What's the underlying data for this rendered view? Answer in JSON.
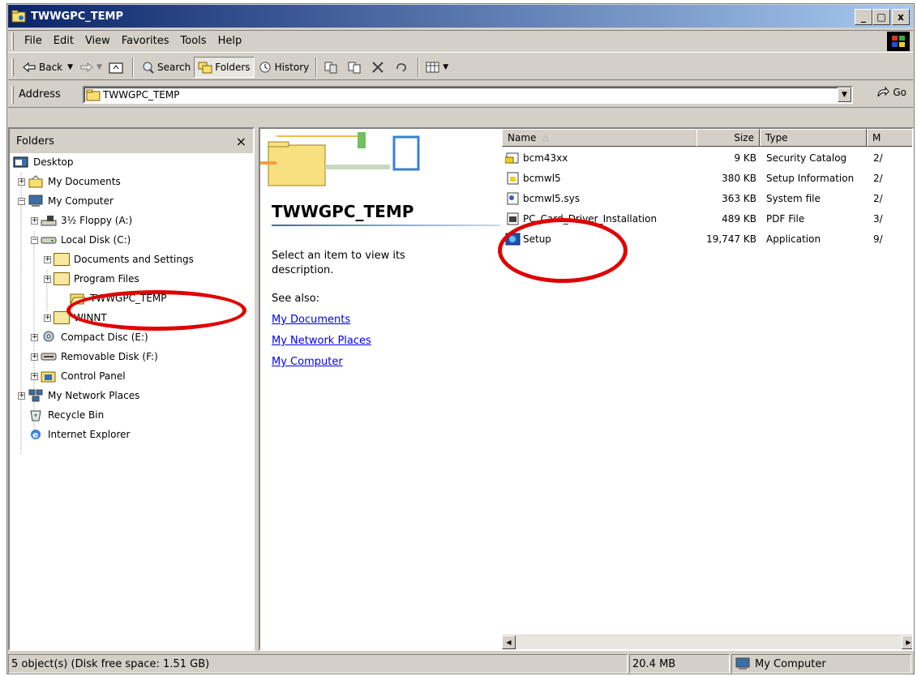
{
  "window": {
    "title": "TWWGPC_TEMP",
    "controls": [
      "_",
      "□",
      "x"
    ]
  },
  "menu": [
    "File",
    "Edit",
    "View",
    "Favorites",
    "Tools",
    "Help"
  ],
  "toolbar": {
    "back": "Back",
    "search": "Search",
    "folders": "Folders",
    "history": "History"
  },
  "address": {
    "label": "Address",
    "value": "TWWGPC_TEMP",
    "go": "Go"
  },
  "folders_pane": {
    "title": "Folders",
    "close": "×",
    "items": [
      {
        "label": "Desktop"
      },
      {
        "label": "My Documents"
      },
      {
        "label": "My Computer"
      },
      {
        "label": "3½ Floppy (A:)"
      },
      {
        "label": "Local Disk (C:)"
      },
      {
        "label": "Documents and Settings"
      },
      {
        "label": "Program Files"
      },
      {
        "label": "TWWGPC_TEMP"
      },
      {
        "label": "WINNT"
      },
      {
        "label": "Compact Disc (E:)"
      },
      {
        "label": "Removable Disk (F:)"
      },
      {
        "label": "Control Panel"
      },
      {
        "label": "My Network Places"
      },
      {
        "label": "Recycle Bin"
      },
      {
        "label": "Internet Explorer"
      }
    ]
  },
  "webview": {
    "folder_name": "TWWGPC_TEMP",
    "description": "Select an item to view its description.",
    "see_also": "See also:",
    "links": [
      "My Documents",
      "My Network Places",
      "My Computer"
    ]
  },
  "file_list": {
    "columns": [
      "Name",
      "Size",
      "Type",
      "M"
    ],
    "rows": [
      {
        "name": "bcm43xx",
        "size": "9 KB",
        "type": "Security Catalog",
        "modified": "2/"
      },
      {
        "name": "bcmwl5",
        "size": "380 KB",
        "type": "Setup Information",
        "modified": "2/"
      },
      {
        "name": "bcmwl5.sys",
        "size": "363 KB",
        "type": "System file",
        "modified": "2/"
      },
      {
        "name": "PC_Card_Driver_Installation",
        "size": "489 KB",
        "type": "PDF File",
        "modified": "3/"
      },
      {
        "name": "Setup",
        "size": "19,747 KB",
        "type": "Application",
        "modified": "9/"
      }
    ]
  },
  "status": {
    "objects": "5 object(s) (Disk free space: 1.51 GB)",
    "size": "20.4 MB",
    "zone": "My Computer"
  },
  "colors": {
    "titlebar": "#0a246a",
    "annotation": "#e00000",
    "link": "#0000ee"
  }
}
